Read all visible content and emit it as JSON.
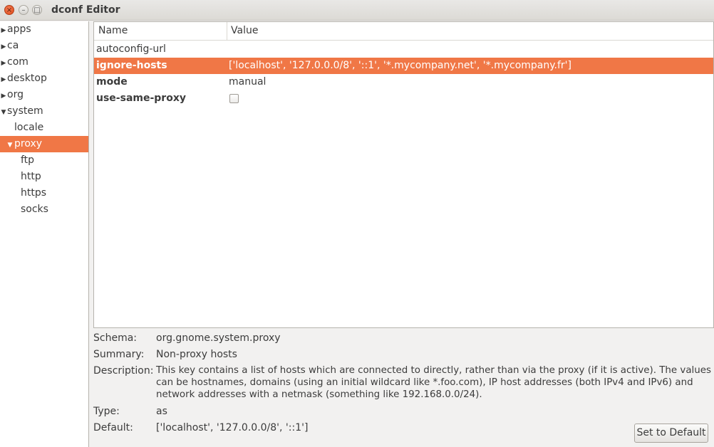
{
  "window": {
    "title": "dconf Editor",
    "close_glyph": "×",
    "min_glyph": "–",
    "max_glyph": "□"
  },
  "tree": {
    "items": [
      {
        "label": "apps",
        "expander": "▶"
      },
      {
        "label": "ca",
        "expander": "▶"
      },
      {
        "label": "com",
        "expander": "▶"
      },
      {
        "label": "desktop",
        "expander": "▶"
      },
      {
        "label": "org",
        "expander": "▶"
      },
      {
        "label": "system",
        "expander": "▼"
      },
      {
        "label": "locale",
        "expander": ""
      },
      {
        "label": "proxy",
        "expander": "▼"
      },
      {
        "label": "ftp",
        "expander": ""
      },
      {
        "label": "http",
        "expander": ""
      },
      {
        "label": "https",
        "expander": ""
      },
      {
        "label": "socks",
        "expander": ""
      }
    ]
  },
  "keys": {
    "columns": {
      "name": "Name",
      "value": "Value"
    },
    "rows": [
      {
        "name": "autoconfig-url",
        "value": ""
      },
      {
        "name": "ignore-hosts",
        "value": "['localhost', '127.0.0.0/8', '::1', '*.mycompany.net', '*.mycompany.fr']"
      },
      {
        "name": "mode",
        "value": "manual"
      },
      {
        "name": "use-same-proxy",
        "value": false
      }
    ]
  },
  "details": {
    "schema_label": "Schema:",
    "schema": "org.gnome.system.proxy",
    "summary_label": "Summary:",
    "summary": "Non-proxy hosts",
    "description_label": "Description:",
    "description_lines": [
      "This key contains a list of hosts which are connected to directly, rather than via the proxy (if it is active). The values",
      "can be hostnames, domains (using an initial wildcard like *.foo.com), IP host addresses (both IPv4 and IPv6) and",
      "network addresses with a netmask (something like 192.168.0.0/24)."
    ],
    "type_label": "Type:",
    "type": "as",
    "default_label": "Default:",
    "default": "['localhost', '127.0.0.0/8', '::1']",
    "set_default_button": "Set to Default"
  },
  "colors": {
    "selection": "#f07746",
    "close_button": "#df4a16"
  }
}
